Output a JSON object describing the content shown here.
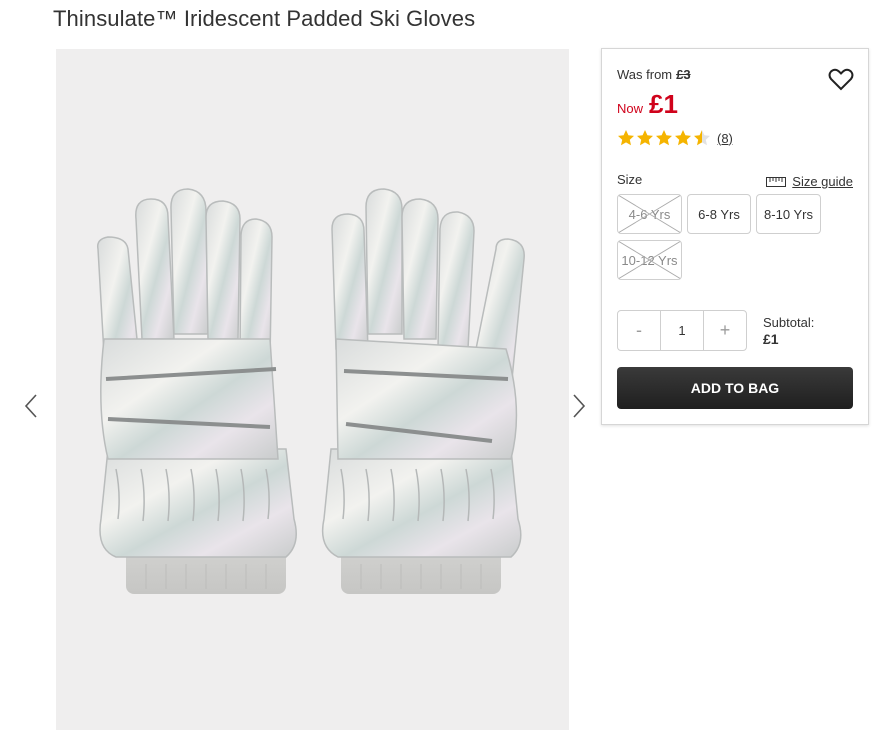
{
  "product": {
    "title": "Thinsulate™ Iridescent Padded Ski Gloves",
    "image_alt": "Silver iridescent padded ski gloves"
  },
  "pricing": {
    "was_label": "Was from",
    "was_price": "£3",
    "now_label": "Now",
    "now_price": "£1",
    "sale_color": "#d0021b"
  },
  "rating": {
    "stars": 4.5,
    "count_label": "(8)",
    "star_color": "#f5b400"
  },
  "size": {
    "label": "Size",
    "guide_label": "Size guide",
    "options": [
      {
        "label": "4-6 Yrs",
        "available": false
      },
      {
        "label": "6-8 Yrs",
        "available": true
      },
      {
        "label": "8-10 Yrs",
        "available": true
      },
      {
        "label": "10-12 Yrs",
        "available": false
      }
    ]
  },
  "quantity": {
    "minus": "-",
    "value": "1",
    "plus": "+"
  },
  "subtotal": {
    "label": "Subtotal:",
    "value": "£1"
  },
  "actions": {
    "add_to_bag": "ADD TO BAG"
  },
  "icons": {
    "wishlist": "heart-icon",
    "prev": "chevron-left-icon",
    "next": "chevron-right-icon",
    "size_guide": "ruler-icon"
  }
}
